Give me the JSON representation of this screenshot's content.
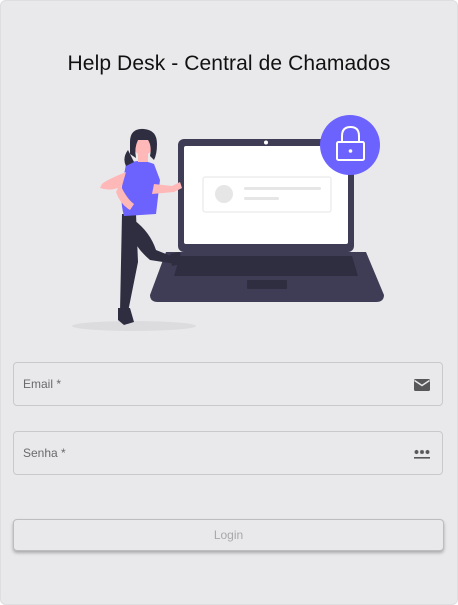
{
  "header": {
    "title": "Help Desk - Central de Chamados"
  },
  "illustration": {
    "name": "laptop-security-illustration",
    "accent_color": "#6c63ff"
  },
  "form": {
    "email": {
      "label": "Email *",
      "value": "",
      "icon": "email-icon"
    },
    "senha": {
      "label": "Senha *",
      "value": "",
      "icon": "password-icon"
    },
    "login_label": "Login"
  }
}
